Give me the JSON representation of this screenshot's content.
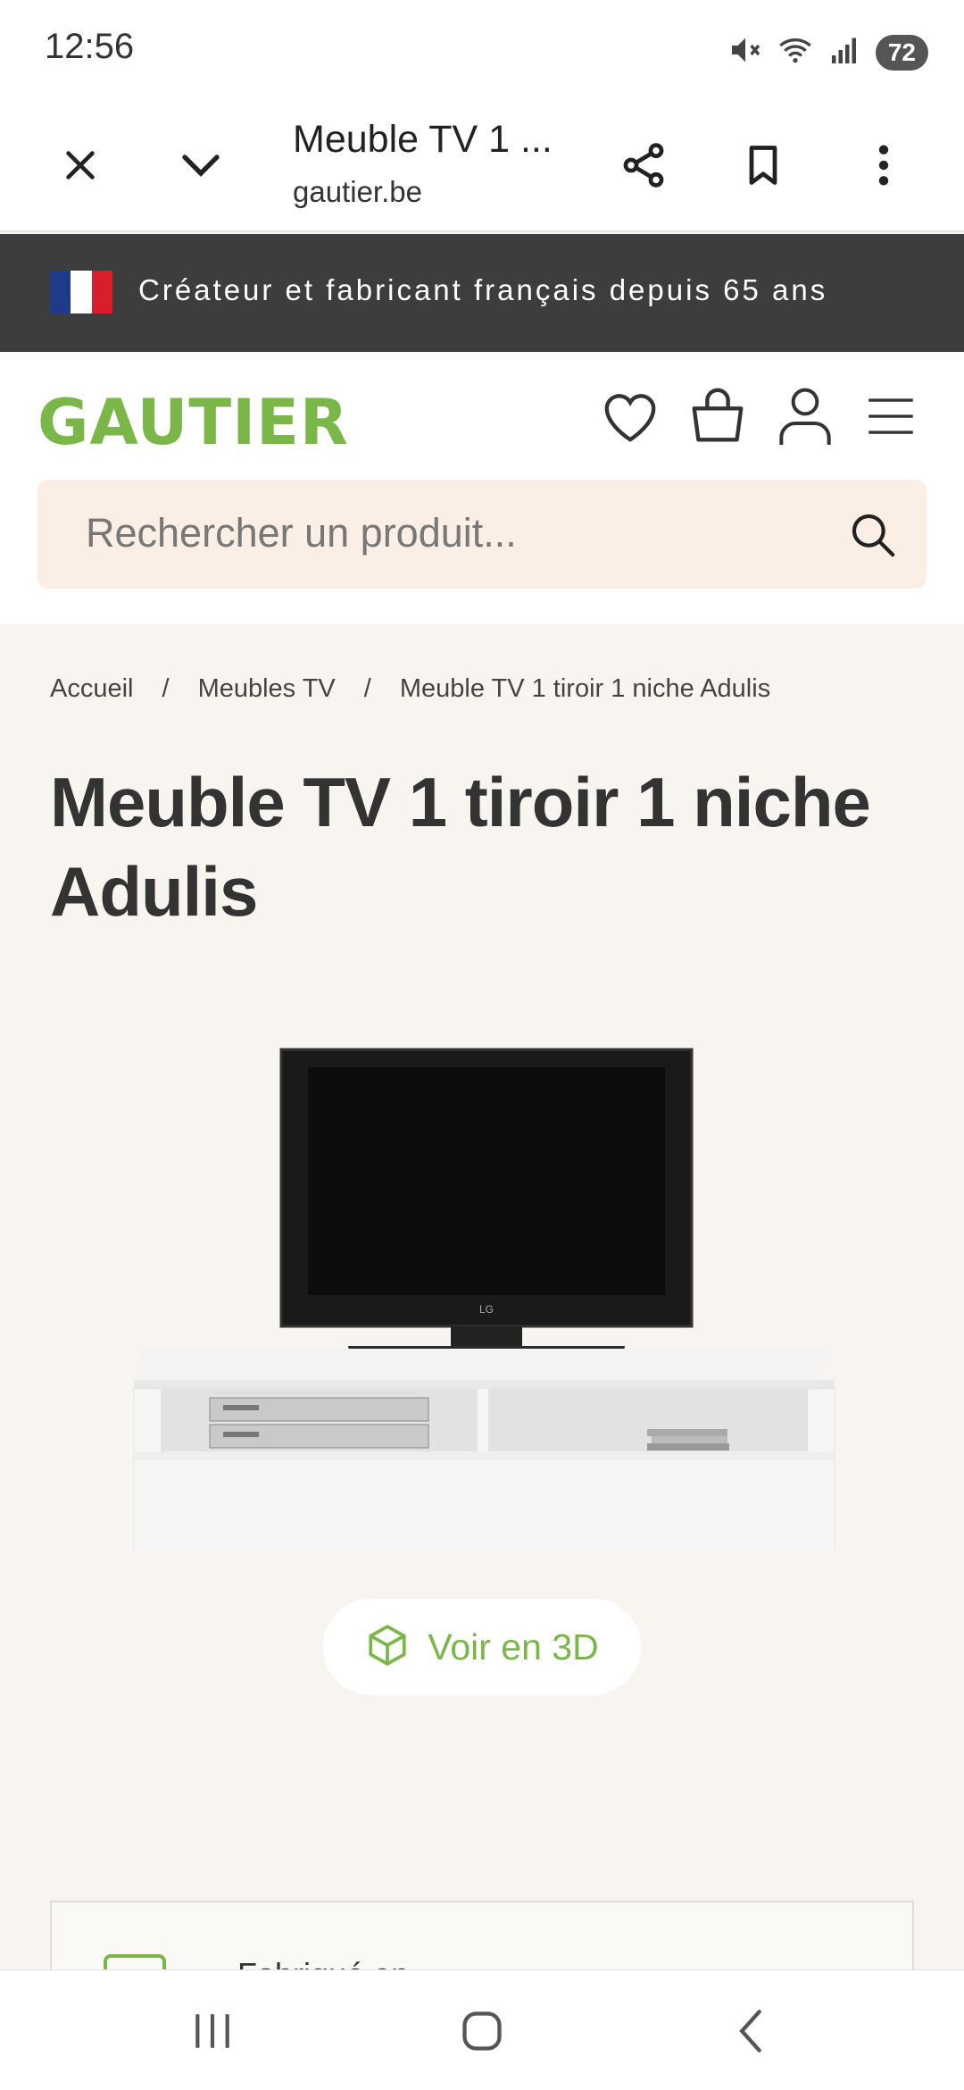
{
  "status": {
    "time": "12:56",
    "battery": "72"
  },
  "browser": {
    "title": "Meuble TV 1 ...",
    "domain": "gautier.be"
  },
  "banner": {
    "text": "Créateur et fabricant français depuis 65 ans",
    "flag_colors": [
      "#1e3a8a",
      "#ffffff",
      "#d81e2a"
    ]
  },
  "header": {
    "logo": "GAUTIER",
    "brand_color": "#7ab648"
  },
  "search": {
    "placeholder": "Rechercher un produit..."
  },
  "breadcrumb": {
    "items": [
      "Accueil",
      "Meubles TV",
      "Meuble TV 1 tiroir 1 niche Adulis"
    ],
    "separator": "/"
  },
  "product": {
    "title": "Meuble TV 1 tiroir 1 niche Adulis",
    "view3d_label": "Voir en 3D",
    "tv_brand_mark": "LG"
  },
  "info_card": {
    "text": "Fabriqué en ..."
  }
}
